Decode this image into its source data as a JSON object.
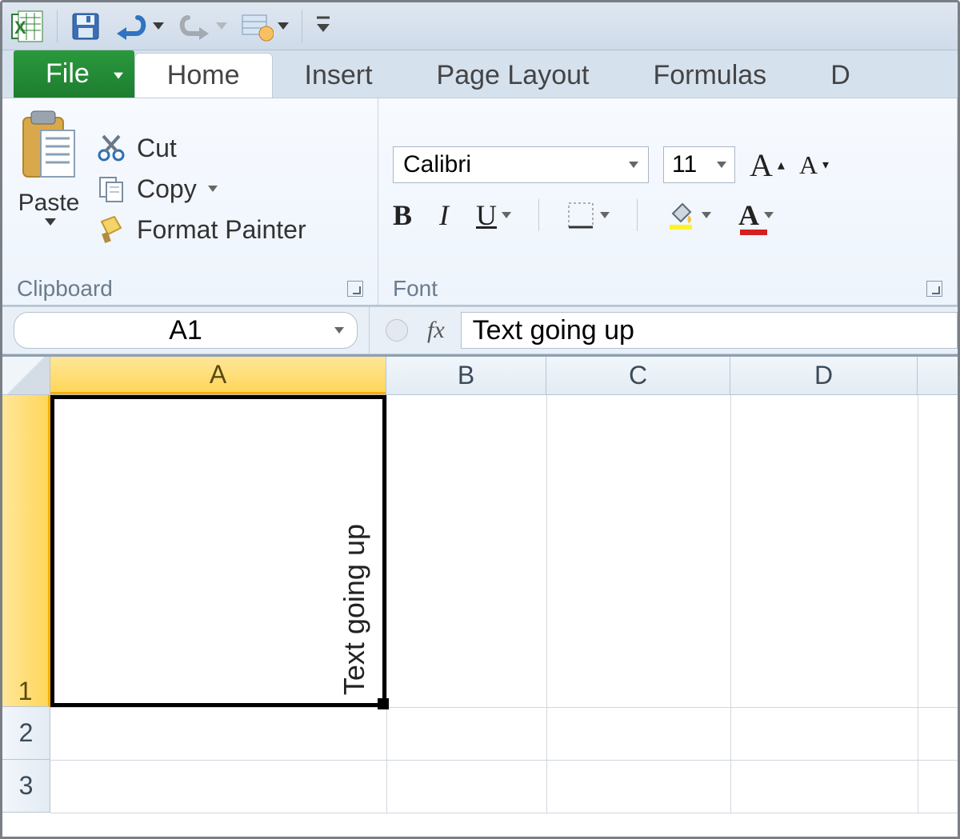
{
  "qat": {
    "items": [
      "excel",
      "save",
      "undo",
      "redo",
      "customize"
    ]
  },
  "tabs": {
    "file": "File",
    "list": [
      "Home",
      "Insert",
      "Page Layout",
      "Formulas",
      "D"
    ],
    "active": "Home"
  },
  "ribbon": {
    "clipboard": {
      "paste_label": "Paste",
      "cut_label": "Cut",
      "copy_label": "Copy",
      "format_painter_label": "Format Painter",
      "group_title": "Clipboard"
    },
    "font": {
      "name": "Calibri",
      "size": "11",
      "group_title": "Font"
    }
  },
  "formula_bar": {
    "name_box": "A1",
    "fx_label": "fx",
    "formula": "Text going up"
  },
  "grid": {
    "columns": [
      "A",
      "B",
      "C",
      "D"
    ],
    "rows": [
      "1",
      "2",
      "3"
    ],
    "active_col": "A",
    "active_row": "1",
    "cells": {
      "A1": "Text going up"
    }
  }
}
